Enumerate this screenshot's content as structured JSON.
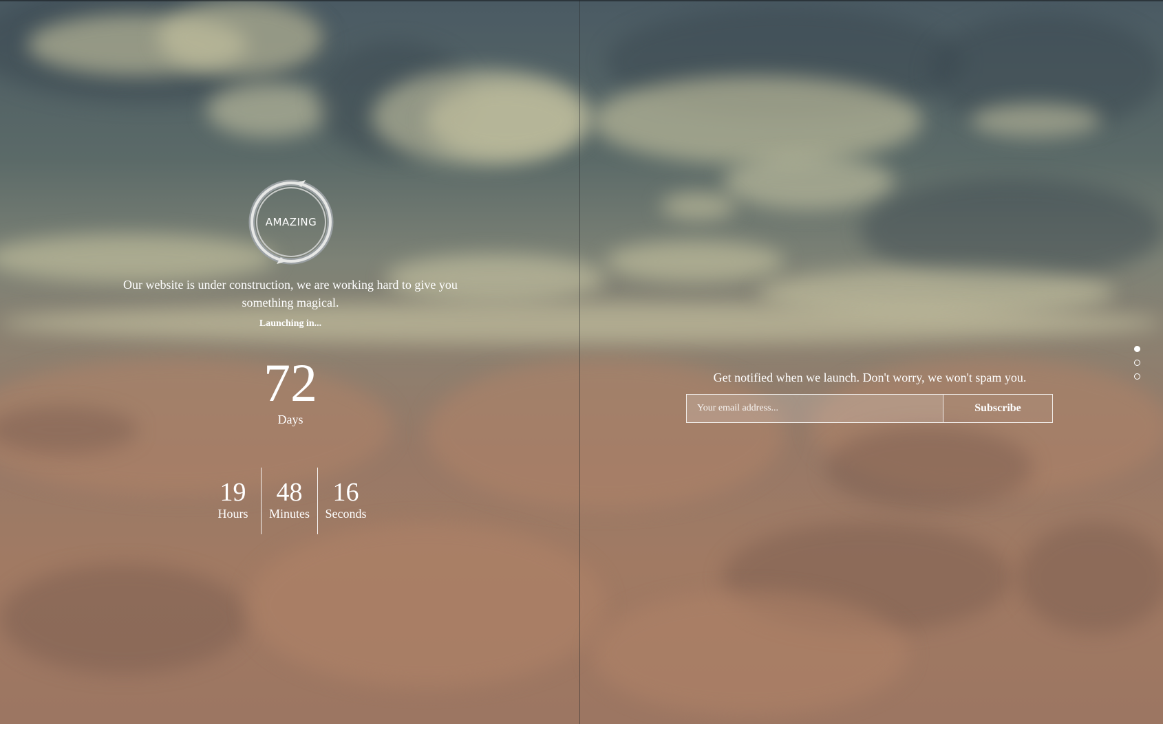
{
  "logo": {
    "text": "AMAZING",
    "icon": "circular-arrow-ring-icon"
  },
  "intro": {
    "message": "Our website is under construction, we are working hard to give you something magical.",
    "launching_label": "Launching in..."
  },
  "countdown": {
    "days": {
      "value": "72",
      "label": "Days"
    },
    "hours": {
      "value": "19",
      "label": "Hours"
    },
    "minutes": {
      "value": "48",
      "label": "Minutes"
    },
    "seconds": {
      "value": "16",
      "label": "Seconds"
    }
  },
  "subscribe": {
    "message": "Get notified when we launch. Don't worry, we won't spam you.",
    "email_placeholder": "Your email address...",
    "email_value": "",
    "button_label": "Subscribe"
  },
  "pagination": {
    "count": 3,
    "active_index": 0
  },
  "colors": {
    "text": "#ffffff",
    "sky_dark": "#4a5a63",
    "cloud_warm": "#a17a63"
  }
}
